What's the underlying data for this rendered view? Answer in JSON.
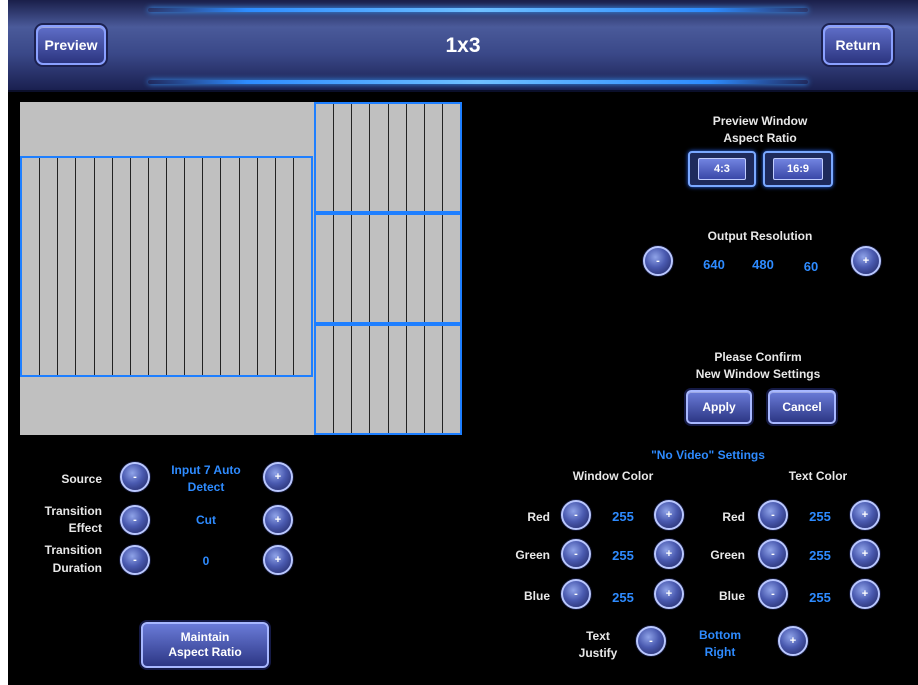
{
  "header": {
    "title": "1x3",
    "preview_label": "Preview",
    "return_label": "Return"
  },
  "colors": {
    "background": "#000000",
    "accent_blue": "#2e8bff",
    "window_outline": "#1e7fff",
    "canvas_gray": "#c0c0c0",
    "button_blue": "#3a48a8"
  },
  "preview_window": {
    "title_line1": "Preview Window",
    "title_line2": "Aspect Ratio",
    "options": [
      "4:3",
      "16:9"
    ]
  },
  "output_resolution": {
    "label": "Output Resolution",
    "width": "640",
    "height": "480",
    "refresh": "60",
    "minus_icon": "minus-icon",
    "plus_icon": "plus-icon"
  },
  "confirm": {
    "line1": "Please Confirm",
    "line2": "New Window Settings",
    "apply_label": "Apply",
    "cancel_label": "Cancel"
  },
  "left_controls": {
    "source_label": "Source",
    "source_value_line1": "Input 7 Auto",
    "source_value_line2": "Detect",
    "transition_effect_label_line1": "Transition",
    "transition_effect_label_line2": "Effect",
    "transition_effect_value": "Cut",
    "transition_duration_label_line1": "Transition",
    "transition_duration_label_line2": "Duration",
    "transition_duration_value": "0",
    "maintain_label": "Maintain\nAspect Ratio"
  },
  "no_video": {
    "title": "\"No Video\" Settings",
    "window_color_header": "Window  Color",
    "text_color_header": "Text Color",
    "window_color": [
      {
        "label": "Red",
        "value": "255"
      },
      {
        "label": "Green",
        "value": "255"
      },
      {
        "label": "Blue",
        "value": "255"
      }
    ],
    "text_color": [
      {
        "label": "Red",
        "value": "255"
      },
      {
        "label": "Green",
        "value": "255"
      },
      {
        "label": "Blue",
        "value": "255"
      }
    ],
    "text_justify_label_line1": "Text",
    "text_justify_label_line2": "Justify",
    "text_justify_value_line1": "Bottom",
    "text_justify_value_line2": "Right"
  },
  "icons": {
    "minus": "-",
    "plus": "+"
  },
  "layout_windows": {
    "count": 4,
    "stripes_large": 16,
    "stripes_small": 8
  }
}
